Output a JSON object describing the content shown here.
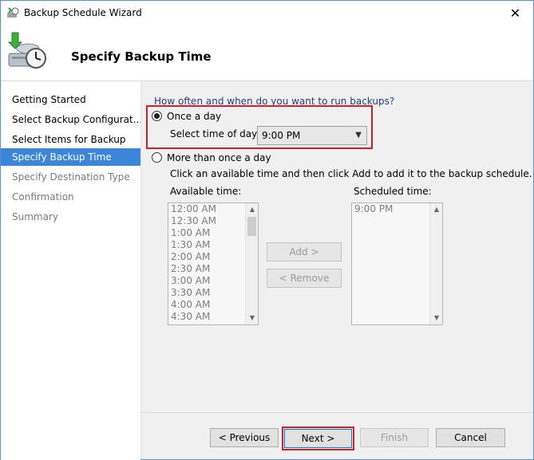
{
  "window": {
    "title": "Backup Schedule Wizard",
    "close_glyph": "✕"
  },
  "header": {
    "title": "Specify Backup Time",
    "icon": "backup-clock-icon"
  },
  "nav": {
    "items": [
      {
        "label": "Getting Started",
        "state": "normal"
      },
      {
        "label": "Select Backup Configurat...",
        "state": "normal"
      },
      {
        "label": "Select Items for Backup",
        "state": "normal"
      },
      {
        "label": "Specify Backup Time",
        "state": "active"
      },
      {
        "label": "Specify Destination Type",
        "state": "disabled"
      },
      {
        "label": "Confirmation",
        "state": "disabled"
      },
      {
        "label": "Summary",
        "state": "disabled"
      }
    ]
  },
  "content": {
    "question": "How often and when do you want to run backups?",
    "once_a_day_label": "Once a day",
    "select_time_label": "Select time of day:",
    "selected_time": "9:00 PM",
    "more_than_once_label": "More than once a day",
    "instructions": "Click an available time and then click Add to add it to the backup schedule.",
    "available_label": "Available time:",
    "scheduled_label": "Scheduled time:",
    "available_times": [
      "12:00 AM",
      "12:30 AM",
      "1:00 AM",
      "1:30 AM",
      "2:00 AM",
      "2:30 AM",
      "3:00 AM",
      "3:30 AM",
      "4:00 AM",
      "4:30 AM"
    ],
    "scheduled_times": [
      "9:00 PM"
    ],
    "add_button": "Add >",
    "remove_button": "< Remove"
  },
  "footer": {
    "previous": "< Previous",
    "next": "Next >",
    "finish": "Finish",
    "cancel": "Cancel"
  },
  "colors": {
    "accent": "#3b86d9",
    "highlight": "#d11f2a",
    "question_text": "#1e3e8a"
  }
}
